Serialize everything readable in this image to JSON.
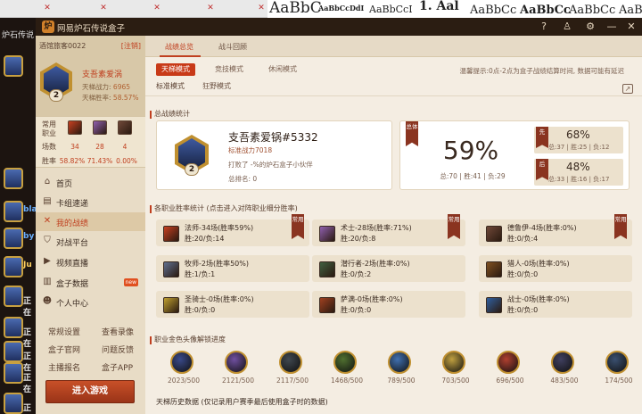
{
  "background": {
    "word_styles": [
      "AaBbC",
      "AaBbCcDdI",
      "AaBbCcI",
      "1. Aal",
      "AaBbCc",
      "AaBbCc",
      "AaBbCc",
      "AaBbCc"
    ],
    "left_tab_title": "炉石传说",
    "left_items": [
      "bla",
      "by",
      "Ju",
      "正在",
      "正在",
      "正在",
      "正在",
      "正在"
    ]
  },
  "window": {
    "title": "网易炉石传说盒子",
    "title_icons": [
      "help-icon",
      "shirt-icon",
      "settings-icon",
      "minimize-icon",
      "close-icon"
    ]
  },
  "sidebar": {
    "account": "酒馆旅客0022",
    "logout": "[注销]",
    "rank": "2",
    "name": "支吾素爱涡",
    "power_label": "天梯战力:",
    "power_value": "6965",
    "winrate_label": "天梯胜率:",
    "winrate_value": "58.57%",
    "stats": {
      "common_label": "常用职业",
      "games_label": "场数",
      "winrate_label": "胜率",
      "games": [
        "34",
        "28",
        "4"
      ],
      "rates": [
        "58.82%",
        "71.43%",
        "0.00%"
      ],
      "class_colors": [
        "#c84020",
        "#9060b0",
        "#704838"
      ]
    },
    "nav": [
      {
        "label": "首页",
        "icon": "home-icon"
      },
      {
        "label": "卡组速递",
        "icon": "deck-icon"
      },
      {
        "label": "我的战绩",
        "icon": "swords-icon",
        "active": true
      },
      {
        "label": "对战平台",
        "icon": "shield-icon"
      },
      {
        "label": "视频直播",
        "icon": "video-icon"
      },
      {
        "label": "盒子数据",
        "icon": "chart-icon",
        "badge": "new"
      },
      {
        "label": "个人中心",
        "icon": "user-icon"
      }
    ],
    "links": [
      "常规设置",
      "查看录像",
      "盒子官网",
      "问题反馈",
      "主播报名",
      "盒子APP"
    ],
    "enter_button": "进入游戏"
  },
  "main": {
    "tabs": [
      "战绩总览",
      "战斗回顾"
    ],
    "modes": [
      "天梯模式",
      "竞技模式",
      "休闲模式"
    ],
    "tip": "温馨提示:0点-2点为盒子战绩结算时间, 数据可能有延迟",
    "submodes": [
      "标准模式",
      "狂野模式"
    ],
    "summary_title": "总战绩统计",
    "player_name": "支吾素爱锅#5332",
    "standard_power": "标准战力7018",
    "beat_text": "打败了 -%的炉石盒子小伙伴",
    "total_rank": "总排名: 0",
    "total_ribbon": "总体",
    "total_winrate": "59%",
    "total_detail": "总:70 | 胜:41 | 负:29",
    "first": {
      "ribbon": "先",
      "pct": "68%",
      "detail": "总:37 | 胜:25 | 负:12"
    },
    "second": {
      "ribbon": "后",
      "pct": "48%",
      "detail": "总:33 | 胜:16 | 负:17"
    },
    "class_title": "各职业胜率统计 (点击进入对阵职业细分胜率)",
    "common_ribbon": "常用",
    "classes": [
      {
        "l1": "法师-34场(胜率59%)",
        "l2": "胜:20/负:14",
        "color": "#c84020",
        "common": true
      },
      {
        "l1": "术士-28场(胜率:71%)",
        "l2": "胜:20/负:8",
        "color": "#9060b0",
        "common": true
      },
      {
        "l1": "德鲁伊-4场(胜率:0%)",
        "l2": "胜:0/负:4",
        "color": "#704838",
        "common": true
      },
      {
        "l1": "牧师-2场(胜率50%)",
        "l2": "胜:1/负:1",
        "color": "#607090",
        "common": false
      },
      {
        "l1": "潜行者-2场(胜率:0%)",
        "l2": "胜:0/负:2",
        "color": "#406040",
        "common": false
      },
      {
        "l1": "猎人-0场(胜率:0%)",
        "l2": "胜:0/负:0",
        "color": "#805020",
        "common": false
      },
      {
        "l1": "圣骑士-0场(胜率:0%)",
        "l2": "胜:0/负:0",
        "color": "#c0a030",
        "common": false
      },
      {
        "l1": "萨满-0场(胜率:0%)",
        "l2": "胜:0/负:0",
        "color": "#a04020",
        "common": false
      },
      {
        "l1": "战士-0场(胜率:0%)",
        "l2": "胜:0/负:0",
        "color": "#3060a0",
        "common": false
      }
    ],
    "heroes_title": "职业金色头像解锁进度",
    "heroes": [
      {
        "value": "2023/500",
        "color": "#3a4a8a"
      },
      {
        "value": "2121/500",
        "color": "#7050a0"
      },
      {
        "value": "2117/500",
        "color": "#404850"
      },
      {
        "value": "1468/500",
        "color": "#507030"
      },
      {
        "value": "789/500",
        "color": "#4070b0"
      },
      {
        "value": "703/500",
        "color": "#c0a040"
      },
      {
        "value": "696/500",
        "color": "#b04030"
      },
      {
        "value": "483/500",
        "color": "#404060"
      },
      {
        "value": "174/500",
        "color": "#3a5070"
      }
    ],
    "history_title": "天梯历史数据 (仅记录用户赛季最后使用盒子时的数据)"
  }
}
